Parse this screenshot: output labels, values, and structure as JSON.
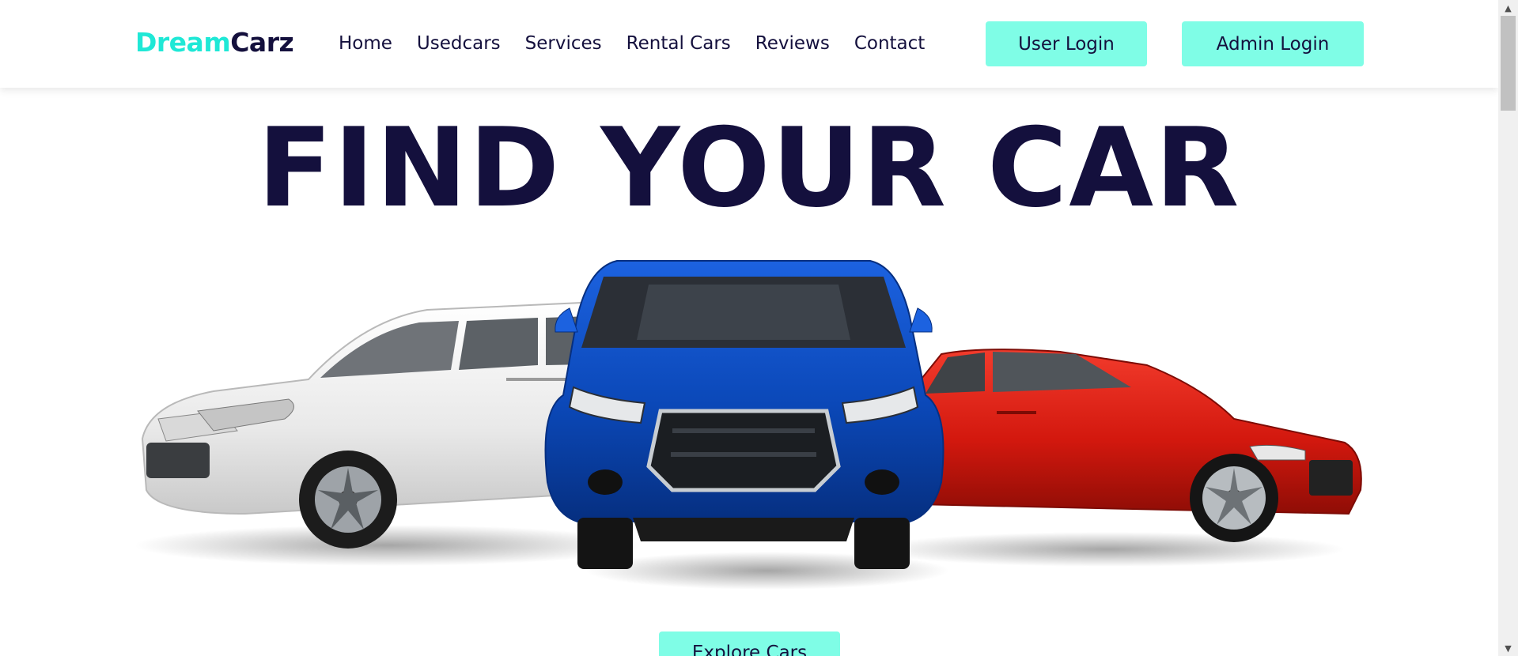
{
  "header": {
    "logo_part1": "Dream",
    "logo_part2": "Carz",
    "nav": [
      "Home",
      "Usedcars",
      "Services",
      "Rental Cars",
      "Reviews",
      "Contact"
    ],
    "user_login": "User Login",
    "admin_login": "Admin Login"
  },
  "hero": {
    "title": "FIND YOUR CAR",
    "explore_button": "Explore Cars",
    "image": "cars-lineup-image"
  },
  "colors": {
    "accent": "#7ffde6",
    "logo_accent": "#1fe8d6",
    "navy": "#14103d",
    "car_white": "#f2f2f2",
    "car_blue": "#0b48b8",
    "car_red": "#d3180e"
  }
}
